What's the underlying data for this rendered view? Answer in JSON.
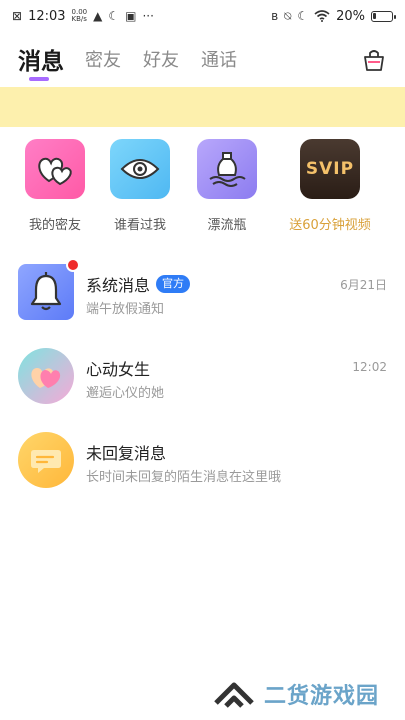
{
  "status_bar": {
    "time": "12:03",
    "net_speed": "0.00",
    "net_unit": "KB/s",
    "battery": "20%",
    "battery_level": 0.2
  },
  "tabs": [
    {
      "label": "消息",
      "active": true
    },
    {
      "label": "密友",
      "active": false
    },
    {
      "label": "好友",
      "active": false
    },
    {
      "label": "通话",
      "active": false
    }
  ],
  "features": [
    {
      "label": "我的密友",
      "icon": "hearts-icon",
      "color": "#ff6fb7"
    },
    {
      "label": "谁看过我",
      "icon": "eye-icon",
      "color": "#5fc3f7"
    },
    {
      "label": "漂流瓶",
      "icon": "bottle-icon",
      "color": "#a99cf6"
    },
    {
      "label": "送60分钟视频",
      "icon": "svip-icon",
      "logo_text": "SVIP",
      "color": "#3a2a22"
    }
  ],
  "messages": [
    {
      "title": "系统消息",
      "badge": "官方",
      "subtitle": "端午放假通知",
      "time": "6月21日",
      "icon": "bell-icon",
      "unread": true
    },
    {
      "title": "心动女生",
      "subtitle": "邂逅心仪的她",
      "time": "12:02",
      "icon": "heart-icon"
    },
    {
      "title": "未回复消息",
      "subtitle": "长时间未回复的陌生消息在这里哦",
      "time": "",
      "icon": "chat-bubble-icon"
    }
  ],
  "watermark": {
    "text": "二货游戏园"
  },
  "colors": {
    "accent_purple": "#a86bff",
    "banner_yellow": "#fdf0ad",
    "official_blue": "#2f7cf6",
    "svip_gold": "#d9a13a"
  }
}
